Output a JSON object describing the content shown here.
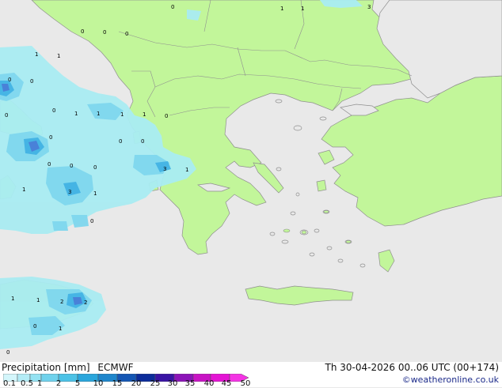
{
  "map": {
    "colors": {
      "sea": "#e9e9e9",
      "land": "#c2f69a",
      "coast": "#9a9a9a",
      "border": "#9a9a9a",
      "precip_light": "#a9ecf2",
      "precip_mid": "#7fd7ee",
      "precip_heavy": "#3fb1e3",
      "precip_peak": "#4a78d6"
    },
    "point_values": [
      "0",
      "1",
      "1",
      "3",
      "0",
      "0",
      "0",
      "1",
      "1",
      "0",
      "0",
      "0",
      "0",
      "1",
      "1",
      "1",
      "1",
      "0",
      "0",
      "0",
      "0",
      "0",
      "0",
      "0",
      "3",
      "1",
      "1",
      "3",
      "1",
      "0",
      "1",
      "1",
      "2",
      "2",
      "0",
      "1",
      "0"
    ]
  },
  "legend": {
    "title": "Precipitation [mm]",
    "model": "ECMWF",
    "ticks": [
      "0.1",
      "0.5",
      "1",
      "2",
      "5",
      "10",
      "15",
      "20",
      "25",
      "30",
      "35",
      "40",
      "45",
      "50"
    ],
    "colors": [
      "#ffffff",
      "#d4f6fb",
      "#b4ecf6",
      "#94e2f2",
      "#70d2ec",
      "#4cc2e6",
      "#2aa6dc",
      "#1e86cc",
      "#1456b4",
      "#0c2c9a",
      "#3a14a4",
      "#8c14b8",
      "#c814c4",
      "#e414d4",
      "#f434e4"
    ]
  },
  "valid_time": "Th 30-04-2026 00..06 UTC (00+174)",
  "credit": "©weatheronline.co.uk"
}
